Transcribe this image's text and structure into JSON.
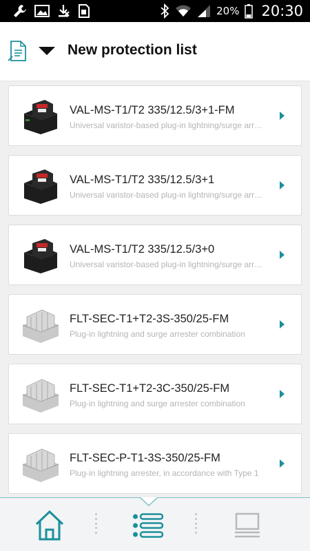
{
  "status_bar": {
    "battery_percent": "20%",
    "time": "20:30",
    "left_icons": [
      "wrench-icon",
      "image-icon",
      "download-off-icon",
      "sim-icon"
    ],
    "right_icons": [
      "bluetooth-icon",
      "wifi-icon",
      "signal-icon",
      "battery-icon"
    ]
  },
  "header": {
    "title": "New protection list",
    "icon": "document-list-icon",
    "dropdown_icon": "caret-down-icon"
  },
  "colors": {
    "accent": "#1b8f9b",
    "accent_light": "#7ec1c8"
  },
  "products": [
    {
      "name": "VAL-MS-T1/T2 335/12.5/3+1-FM",
      "description": "Universal varistor-based plug-in lightning/surge arrester",
      "image": "black-arrester"
    },
    {
      "name": "VAL-MS-T1/T2 335/12.5/3+1",
      "description": "Universal varistor-based plug-in lightning/surge arrester",
      "image": "black-arrester"
    },
    {
      "name": "VAL-MS-T1/T2 335/12.5/3+0",
      "description": "Universal varistor-based plug-in lightning/surge arrester",
      "image": "black-arrester"
    },
    {
      "name": "FLT-SEC-T1+T2-3S-350/25-FM",
      "description": "Plug-in lightning and surge arrester combination",
      "image": "gray-arrester"
    },
    {
      "name": "FLT-SEC-T1+T2-3C-350/25-FM",
      "description": "Plug-in lightning and surge arrester combination",
      "image": "gray-arrester"
    },
    {
      "name": "FLT-SEC-P-T1-3S-350/25-FM",
      "description": "Plug-in lightning arrester, in accordance with Type 1",
      "image": "gray-arrester"
    }
  ],
  "bottom_nav": {
    "items": [
      {
        "name": "home",
        "icon": "home-icon"
      },
      {
        "name": "list",
        "icon": "list-icon",
        "active": true
      },
      {
        "name": "screen",
        "icon": "screen-icon"
      }
    ]
  }
}
